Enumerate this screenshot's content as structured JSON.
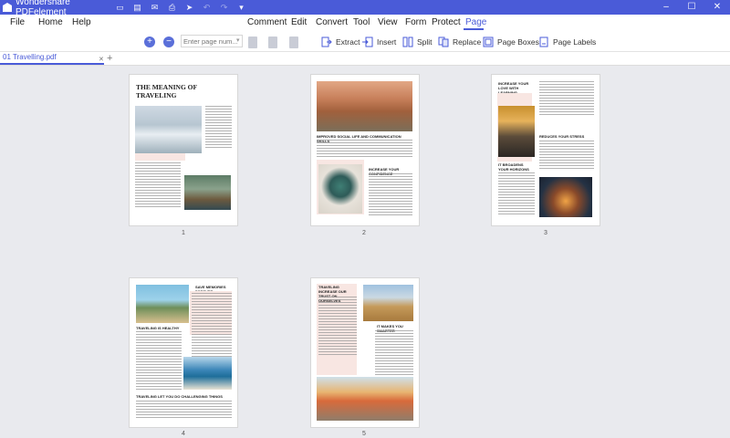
{
  "app": {
    "title": "Wondershare PDFelement"
  },
  "menu": {
    "items": [
      "File",
      "Home",
      "Help",
      "Comment",
      "Edit",
      "Convert",
      "Tool",
      "View",
      "Form",
      "Protect",
      "Page"
    ],
    "active": "Page"
  },
  "toolbar": {
    "page_input_placeholder": "Enter page num...",
    "extract": "Extract",
    "insert": "Insert",
    "split": "Split",
    "replace": "Replace",
    "page_boxes": "Page Boxes",
    "page_labels": "Page Labels"
  },
  "tabs": [
    {
      "label": "01 Travelling.pdf"
    }
  ],
  "pages": [
    {
      "number": "1",
      "heading": "THE MEANING OF TRAVELING"
    },
    {
      "number": "2",
      "heading1": "IMPROVED SOCIAL LIFE AND COMMUNICATION SKILLS",
      "heading2": "INCREASE YOUR CONFIDENCE"
    },
    {
      "number": "3",
      "heading1": "INCREASE YOUR LOVE WITH LEARNING",
      "heading2": "REDUCES YOUR STRESS",
      "heading3": "IT BROADENS YOUR HORIZONS"
    },
    {
      "number": "4",
      "heading1": "SAVE MEMORIES FOREVER",
      "heading2": "TRAVELING IS HEALTHY",
      "heading3": "TRAVELING LET YOU DO CHALLENGING THINGS"
    },
    {
      "number": "5",
      "heading1": "TRAVELING INCREASE OUR TRUST ON OURSELVES",
      "heading2": "IT MAKES YOU SMARTER"
    }
  ],
  "colors": {
    "accent": "#4a5bd8",
    "titlebar": "#4a5bd8"
  }
}
